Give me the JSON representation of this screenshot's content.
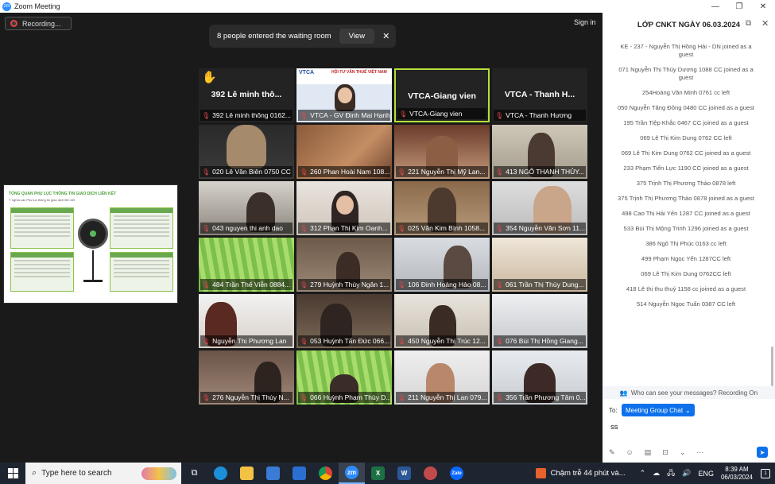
{
  "window": {
    "app_icon": "zm",
    "title": "Zoom Meeting",
    "controls": [
      "minimize-icon",
      "restore-icon",
      "close-icon"
    ]
  },
  "meeting": {
    "recording_label": "Recording...",
    "waiting_room_msg": "8 people entered the waiting room",
    "view_label": "View",
    "dismiss_label": "✕",
    "sign_in": "Sign in"
  },
  "shared_screen": {
    "title": "TỔNG QUAN PHỤ LỤC THÔNG TIN GIAO DỊCH LIÊN KẾT",
    "subtitle": "Ý nghĩa các Phụ lục thông tin giao dịch liên kết"
  },
  "tiles": [
    {
      "label": "392 Lê minh thông 0162...",
      "big_name": "392 Lê minh thô...",
      "hand_raised": true,
      "video": false
    },
    {
      "label": "VTCA - GV Đinh Mai Hạnh",
      "video": true,
      "kind": "presenter",
      "banner": "HỘI TƯ VẤN THUẾ VIỆT NAM",
      "banner_brand": "VTCA"
    },
    {
      "label": "VTCA-Giang vien",
      "big_name": "VTCA-Giang vien",
      "speaking": true,
      "video": false
    },
    {
      "label": "VTCA - Thanh Hương",
      "big_name": "VTCA - Thanh H...",
      "video": false
    },
    {
      "label": "020 Lê Văn Biên 0750 CC",
      "video": true
    },
    {
      "label": "260 Phan Hoài Nam 108...",
      "video": true
    },
    {
      "label": "221 Nguyễn Thị Mỹ Lan...",
      "video": true
    },
    {
      "label": "413 NGÔ THANH THỦY...",
      "video": true
    },
    {
      "label": "043 nguyen thi anh dao",
      "video": true
    },
    {
      "label": "312 Phan Thị Kim Oanh...",
      "video": true
    },
    {
      "label": "025 Văn Kim Bình 1058...",
      "video": true
    },
    {
      "label": "354 Nguyễn Văn Sơn 11...",
      "video": true
    },
    {
      "label": "484 Trần Thế Viễn 0884...",
      "video": true
    },
    {
      "label": "279 Huỳnh Thúy Ngân 1...",
      "video": true
    },
    {
      "label": "106 Đinh Hoàng Hảo 08...",
      "video": true
    },
    {
      "label": "061 Trần Thị Thùy Dung...",
      "video": true
    },
    {
      "label": "Nguyễn Thị Phương Lan",
      "video": true
    },
    {
      "label": "053 Huỳnh Tấn Đức 066...",
      "video": true
    },
    {
      "label": "450 Nguyễn Thị Trúc 12...",
      "video": true
    },
    {
      "label": "076 Bùi Thị Hồng Giang...",
      "video": true
    },
    {
      "label": "276 Nguyễn Thị Thùy N...",
      "video": true
    },
    {
      "label": "066 Huỳnh Phạm Thùy D...",
      "video": true
    },
    {
      "label": "211 Nguyễn Thị Lan 079...",
      "video": true
    },
    {
      "label": "356 Trần Phương Tâm 0...",
      "video": true
    }
  ],
  "chat": {
    "title": "LỚP CNKT NGÀY 06.03.2024",
    "messages": [
      "KE - 237 - Nguyễn Thị Hồng Hải - DN joined as a guest",
      "071 Nguyễn Thị Thúy Dương 1088 CC joined as a guest",
      "254Hoàng Văn Minh 0761 cc left",
      "050 Nguyễn Tăng Đông 0480 CC joined as a guest",
      "195 Trần Tiệp Khắc 0467 CC joined as a guest",
      "069 Lê Thị Kim Dung 0762 CC left",
      "069 Lê Thị Kim Dung 0762 CC joined as a guest",
      "233 Phạm Tiến Lực 1190 CC joined as a guest",
      "375 Trịnh Thị Phương Thảo 0878 left",
      "375 Trịnh Thị Phương Thảo 0878 joined as a guest",
      "498 Cao Thị Hải Yến 1287 CC joined as a guest",
      "533 Bùi Thị Mộng Trinh 1296 joined as a guest",
      "386 Ngô Thị Phúc 0163 cc left",
      "499 Phạm Ngọc Yến 1287CC left",
      "069 Lê Thị Kim Dung 0762CC left",
      "418 Lê thị thu thuỷ 1158 cc joined as a guest",
      "514 Nguyễn Ngọc Tuấn 0387 CC left"
    ],
    "visibility_notice": "Who can see your messages? Recording On",
    "to_label": "To:",
    "recipient": "Meeting Group Chat",
    "draft_text": "ss"
  },
  "taskbar": {
    "search_placeholder": "Type here to search",
    "notification": "Chậm trễ 44 phút và...",
    "lang": "ENG",
    "time": "8:39 AM",
    "date": "06/03/2024",
    "notification_count": "1"
  },
  "colors": {
    "speaking_border": "#b4e03a",
    "zoom_blue": "#0e71eb",
    "muted_mic": "#e14a4a",
    "recording_red": "#e04545"
  }
}
